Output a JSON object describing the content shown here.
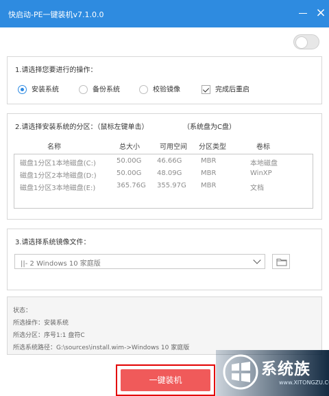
{
  "window": {
    "title": "快启动-PE一键装机v7.1.0.0",
    "minimize_icon": "minimize-icon",
    "close_icon": "close-icon",
    "close_label": "×"
  },
  "colors": {
    "titlebar": "#2e8be0",
    "radio_accent": "#2c89e2",
    "install_button": "#f05a5a",
    "highlight_border": "#e30000"
  },
  "section1": {
    "title": "1.请选择您要进行的操作：",
    "options": [
      {
        "label": "安装系统",
        "selected": true
      },
      {
        "label": "备份系统",
        "selected": false
      },
      {
        "label": "校验镜像",
        "selected": false
      }
    ],
    "checkbox": {
      "label": "完成后重启",
      "checked": true
    }
  },
  "section2": {
    "title": "2.请选择安装系统的分区：（鼠标左键单击）",
    "system_disk": "（系统盘为C盘）",
    "columns": [
      "名称",
      "总大小",
      "可用空间",
      "分区类型",
      "卷标"
    ],
    "rows": [
      [
        "磁盘1分区1本地磁盘(C:)",
        "50.00G",
        "46.66G",
        "MBR",
        "本地磁盘"
      ],
      [
        "磁盘1分区2本地磁盘(D:)",
        "50.00G",
        "48.09G",
        "MBR",
        "WinXP"
      ],
      [
        "磁盘1分区3本地磁盘(E:)",
        "365.76G",
        "355.97G",
        "MBR",
        "文档"
      ]
    ]
  },
  "section3": {
    "title": "3.请选择系统镜像文件：",
    "selected_image": "||- 2 Windows  10 家庭版",
    "dropdown_icon": "chevron-down-icon",
    "browse_icon": "folder-icon"
  },
  "status": {
    "label": "状态：",
    "operation": "所选操作：安装系统",
    "partition": "所选分区：序号1:1   盘符C",
    "path": "所选系统路径：G:\\sources\\install.wim->Windows  10 家庭版"
  },
  "install_button": {
    "label": "一键装机"
  },
  "watermark": {
    "text": "系统族",
    "url": "www.XITONGZU.COM"
  }
}
